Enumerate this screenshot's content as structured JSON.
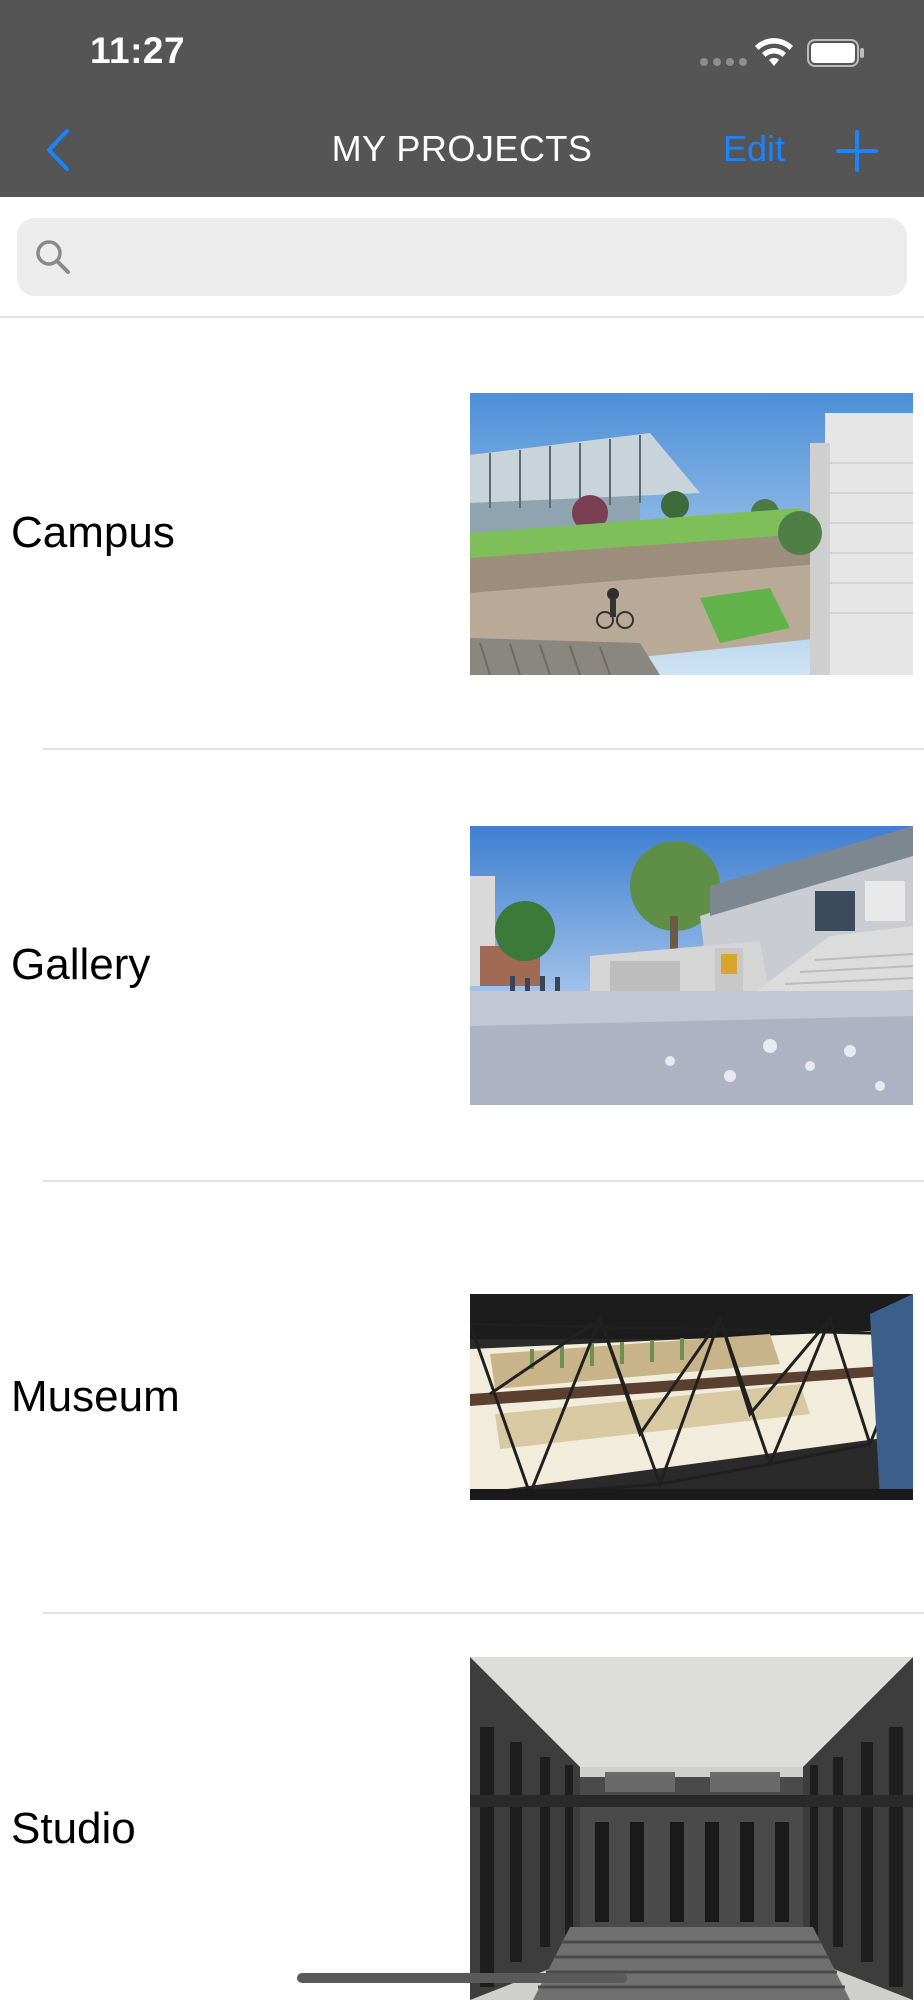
{
  "status_bar": {
    "time": "11:27"
  },
  "nav": {
    "title": "MY PROJECTS",
    "edit_label": "Edit"
  },
  "search": {
    "value": "",
    "placeholder": ""
  },
  "projects": [
    {
      "name": "Campus"
    },
    {
      "name": "Gallery"
    },
    {
      "name": "Museum"
    },
    {
      "name": "Studio"
    }
  ],
  "colors": {
    "header_bg": "#555555",
    "accent": "#1a84ff",
    "search_bg": "#ececec",
    "separator": "#e2e2e2"
  },
  "icons": [
    "back-chevron-icon",
    "add-icon",
    "search-icon",
    "wifi-icon",
    "battery-icon",
    "signal-icon"
  ]
}
